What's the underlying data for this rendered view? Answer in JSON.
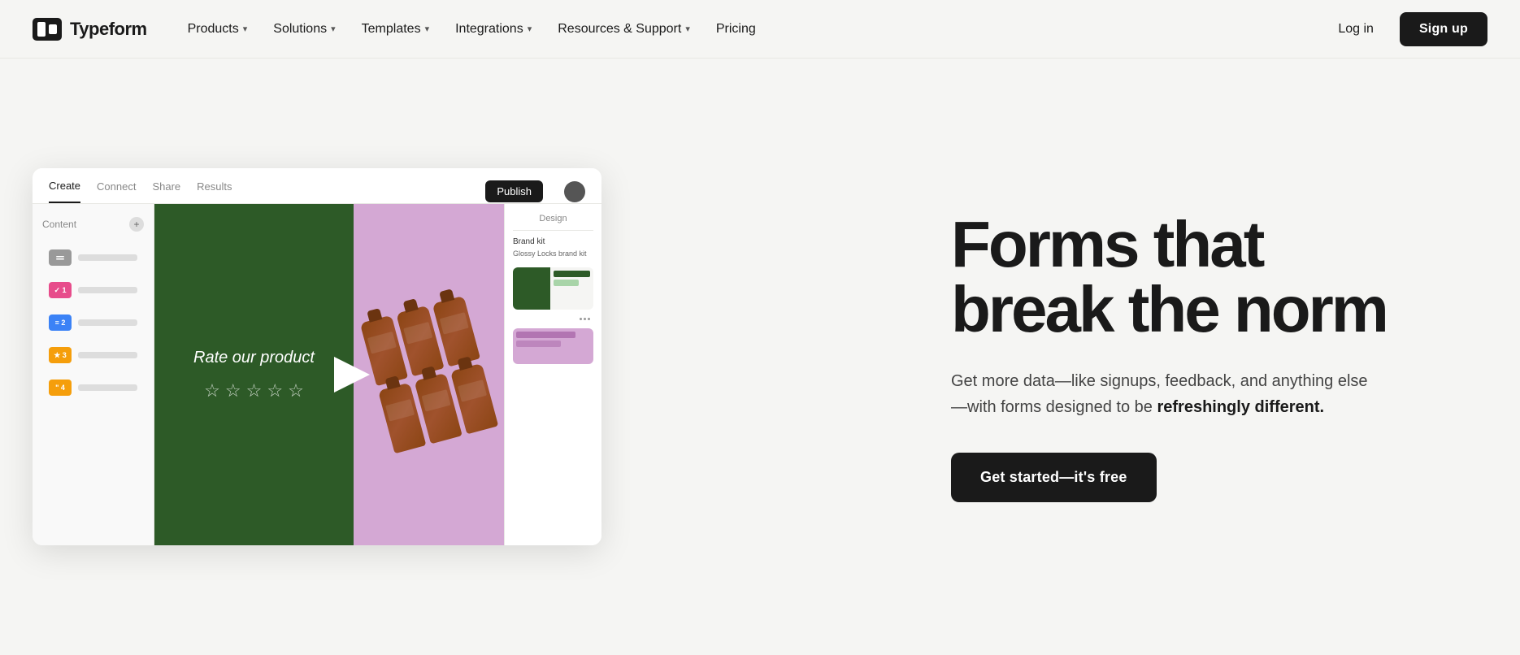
{
  "brand": {
    "name": "Typeform",
    "logo_alt": "Typeform logo"
  },
  "navbar": {
    "links": [
      {
        "label": "Products",
        "has_dropdown": true
      },
      {
        "label": "Solutions",
        "has_dropdown": true
      },
      {
        "label": "Templates",
        "has_dropdown": true
      },
      {
        "label": "Integrations",
        "has_dropdown": true
      },
      {
        "label": "Resources & Support",
        "has_dropdown": true
      },
      {
        "label": "Pricing",
        "has_dropdown": false
      }
    ],
    "login_label": "Log in",
    "signup_label": "Sign up"
  },
  "mockup": {
    "tabs": [
      {
        "label": "Create",
        "active": true
      },
      {
        "label": "Connect",
        "active": false
      },
      {
        "label": "Share",
        "active": false
      },
      {
        "label": "Results",
        "active": false
      }
    ],
    "publish_label": "Publish",
    "sidebar_header": "Content",
    "sidebar_add": "+",
    "sidebar_items": [
      {
        "badge_color": "#888",
        "badge_text": ""
      },
      {
        "badge_color": "#e74c8b",
        "badge_text": "✓ 1"
      },
      {
        "badge_color": "#3b82f6",
        "badge_text": "≡ 2"
      },
      {
        "badge_color": "#f59e0b",
        "badge_text": "★ 3"
      },
      {
        "badge_color": "#f59e0b",
        "badge_text": "\" 4"
      }
    ],
    "form_rate_text": "Rate our product",
    "stars_count": 5,
    "design_label": "Design",
    "brand_kit_label": "Brand kit",
    "glossy_locks_label": "Glossy Locks brand kit"
  },
  "hero": {
    "heading_line1": "Forms that",
    "heading_line2": "break the norm",
    "subtext": "Get more data—like signups, feedback, and anything else—with forms designed to be ",
    "subtext_bold": "refreshingly different.",
    "cta_label": "Get started—it's free"
  }
}
